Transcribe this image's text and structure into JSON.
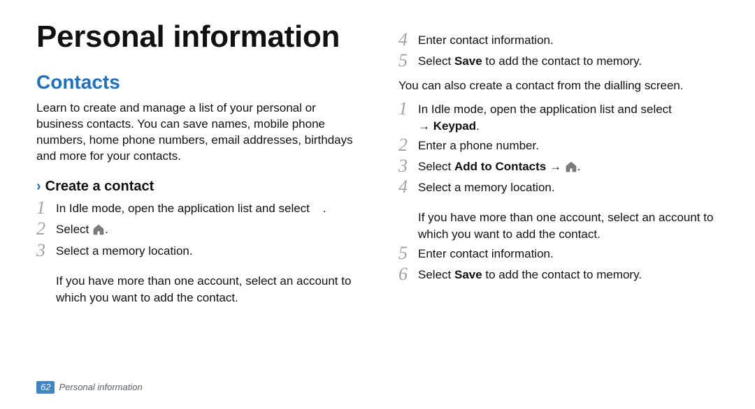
{
  "page": {
    "number": "62",
    "footer_label": "Personal information",
    "title": "Personal information"
  },
  "section": {
    "heading": "Contacts",
    "intro": "Learn to create and manage a list of your personal or business contacts. You can save names, mobile phone numbers, home phone numbers, email addresses, birthdays and more for your contacts."
  },
  "create": {
    "heading": "Create a contact",
    "steps": {
      "s1": "In Idle mode, open the application list and select",
      "s1_suffix": ".",
      "s2_prefix": "Select ",
      "s2_suffix": ".",
      "s3": "Select a memory location.",
      "s3_note": "If you have more than one account, select an account to which you want to add the contact.",
      "s4": "Enter contact information.",
      "s5_prefix": "Select ",
      "s5_bold": "Save",
      "s5_suffix": " to add the contact to memory."
    }
  },
  "alt": {
    "intro": "You can also create a contact from the dialling screen.",
    "steps": {
      "s1_a": "In Idle mode, open the application list and select",
      "s1_arrow": "→ ",
      "s1_bold": "Keypad",
      "s1_suffix": ".",
      "s2": "Enter a phone number.",
      "s3_prefix": "Select ",
      "s3_bold": "Add to Contacts",
      "s3_arrow": " → ",
      "s3_suffix": ".",
      "s4": "Select a memory location.",
      "s4_note": "If you have more than one account, select an account to which you want to add the contact.",
      "s5": "Enter contact information.",
      "s6_prefix": "Select ",
      "s6_bold": "Save",
      "s6_suffix": " to add the contact to memory."
    }
  },
  "nums": {
    "n1": "1",
    "n2": "2",
    "n3": "3",
    "n4": "4",
    "n5": "5",
    "n6": "6"
  },
  "glyphs": {
    "chevron": "›"
  }
}
